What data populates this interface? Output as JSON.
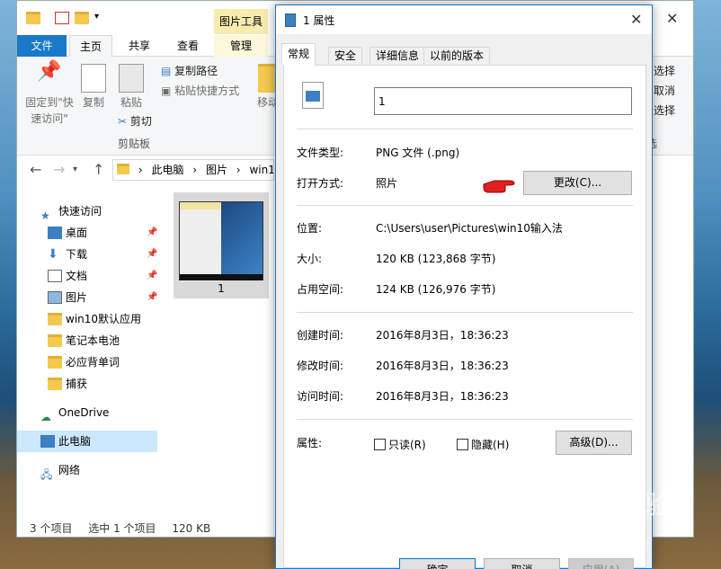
{
  "explorer": {
    "context_tab_header": "图片工具",
    "ribbon_tabs": {
      "file": "文件",
      "home": "主页",
      "share": "共享",
      "view": "查看",
      "manage": "管理"
    },
    "ribbon": {
      "pin_label": "固定到\"快速访问\"",
      "copy_label": "复制",
      "paste_label": "粘贴",
      "copy_path": "复制路径",
      "paste_shortcut": "粘贴快捷方式",
      "cut": "剪切",
      "clipboard_group": "剪贴板",
      "move_label": "移动",
      "select_all": "选择",
      "select_none": "取消",
      "invert_selection": "选择",
      "select_group": "选"
    },
    "address": {
      "segments": [
        "此电脑",
        "图片",
        "win10"
      ]
    },
    "nav": [
      {
        "label": "快速访问"
      },
      {
        "label": "桌面"
      },
      {
        "label": "下载"
      },
      {
        "label": "文档"
      },
      {
        "label": "图片"
      },
      {
        "label": "win10默认应用"
      },
      {
        "label": "笔记本电池"
      },
      {
        "label": "必应背单词"
      },
      {
        "label": "捕获"
      },
      {
        "label": "OneDrive"
      },
      {
        "label": "此电脑"
      },
      {
        "label": "网络"
      }
    ],
    "file": {
      "name": "1"
    },
    "status": {
      "count": "3 个项目",
      "selected": "选中 1 个项目",
      "size": "120 KB"
    }
  },
  "dialog": {
    "title": "1 属性",
    "tabs": [
      "常规",
      "安全",
      "详细信息",
      "以前的版本"
    ],
    "filename": "1",
    "file_type_label": "文件类型:",
    "file_type_value": "PNG 文件 (.png)",
    "open_with_label": "打开方式:",
    "open_with_value": "照片",
    "change_button": "更改(C)...",
    "location_label": "位置:",
    "location_value": "C:\\Users\\user\\Pictures\\win10输入法",
    "size_label": "大小:",
    "size_value": "120 KB (123,868 字节)",
    "disk_label": "占用空间:",
    "disk_value": "124 KB (126,976 字节)",
    "created_label": "创建时间:",
    "created_value": "2016年8月3日，18:36:23",
    "modified_label": "修改时间:",
    "modified_value": "2016年8月3日，18:36:23",
    "accessed_label": "访问时间:",
    "accessed_value": "2016年8月3日，18:36:23",
    "attributes_label": "属性:",
    "readonly_label": "只读(R)",
    "hidden_label": "隐藏(H)",
    "advanced_button": "高级(D)...",
    "ok_button": "确定",
    "cancel_button": "取消",
    "apply_button": "应用(A)"
  },
  "watermark": {
    "main": "Baidu经验",
    "sub": "jingyan.baidu.com"
  },
  "colors": {
    "accent": "#1979ca",
    "selected": "#cce8ff",
    "folder": "#f3c94e"
  }
}
